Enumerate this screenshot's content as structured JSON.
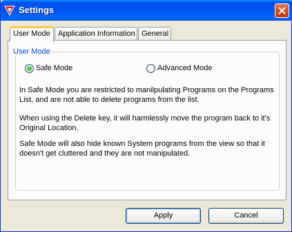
{
  "window": {
    "title": "Settings",
    "close_label": "×"
  },
  "tabs": [
    {
      "label": "User Mode",
      "active": true
    },
    {
      "label": "Application Information",
      "active": false
    },
    {
      "label": "General",
      "active": false
    }
  ],
  "user_mode": {
    "group_label": "User Mode",
    "options": [
      {
        "label": "Safe Mode",
        "selected": true
      },
      {
        "label": "Advanced Mode",
        "selected": false
      }
    ],
    "paragraphs": [
      "In Safe Mode you are restricted to manilpulating Programs on the Programs List, and are not able to delete programs from the list.",
      "When using the Delete key, it will harmlessly move the program back to it's Original Location.",
      "Safe Mode will also hide known System programs from the view so that it doesn't get cluttered and they are not manipulated."
    ]
  },
  "buttons": {
    "apply": "Apply",
    "cancel": "Cancel"
  },
  "colors": {
    "titlebar": "#0053ee",
    "group_label": "#0046d5",
    "active_tab_highlight": "#ffc83c"
  }
}
